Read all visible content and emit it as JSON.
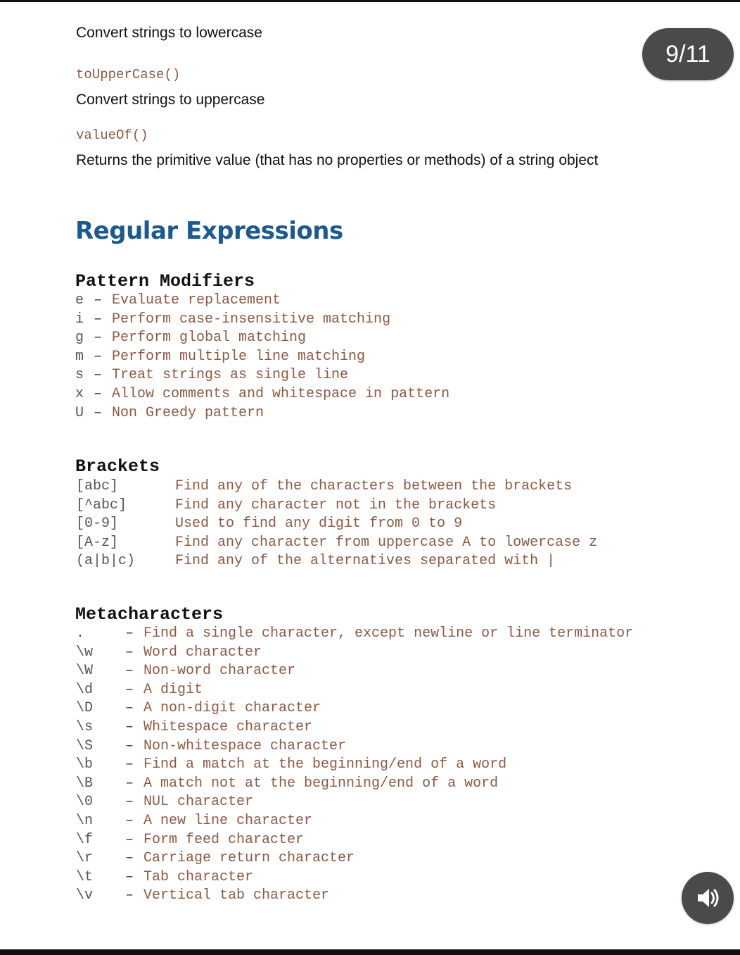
{
  "page_indicator": "9/11",
  "top_items": [
    {
      "description": "Convert strings to lowercase"
    },
    {
      "name": "toUpperCase()",
      "description": "Convert strings to uppercase"
    },
    {
      "name": "valueOf()",
      "description": "Returns the primitive value (that has no properties or methods) of a string object"
    }
  ],
  "section_title": "Regular Expressions",
  "pattern_modifiers": {
    "title": "Pattern Modifiers",
    "items": [
      {
        "key": "e",
        "dash": "–",
        "desc": "Evaluate replacement"
      },
      {
        "key": "i",
        "dash": "–",
        "desc": "Perform case-insensitive matching"
      },
      {
        "key": "g",
        "dash": "–",
        "desc": "Perform global matching"
      },
      {
        "key": "m",
        "dash": "–",
        "desc": "Perform multiple line matching"
      },
      {
        "key": "s",
        "dash": "–",
        "desc": "Treat strings as single line"
      },
      {
        "key": "x",
        "dash": "–",
        "desc": "Allow comments and whitespace in pattern"
      },
      {
        "key": "U",
        "dash": "–",
        "desc": "Non Greedy pattern"
      }
    ]
  },
  "brackets": {
    "title": "Brackets",
    "items": [
      {
        "key": "[abc]",
        "desc": "Find any of the characters between the brackets"
      },
      {
        "key": "[^abc]",
        "desc": "Find any character not in the brackets"
      },
      {
        "key": "[0-9]",
        "desc": "Used to find any digit from 0 to 9"
      },
      {
        "key": "[A-z]",
        "desc": "Find any character from uppercase A to lowercase z"
      },
      {
        "key": "(a|b|c)",
        "desc": "Find any of the alternatives separated with |"
      }
    ]
  },
  "metacharacters": {
    "title": "Metacharacters",
    "items": [
      {
        "key": ".",
        "dash": "–",
        "desc": "Find a single character, except newline or line terminator"
      },
      {
        "key": "\\w",
        "dash": "–",
        "desc": "Word character"
      },
      {
        "key": "\\W",
        "dash": "–",
        "desc": "Non-word character"
      },
      {
        "key": "\\d",
        "dash": "–",
        "desc": "A digit"
      },
      {
        "key": "\\D",
        "dash": "–",
        "desc": "A non-digit character"
      },
      {
        "key": "\\s",
        "dash": "–",
        "desc": "Whitespace character"
      },
      {
        "key": "\\S",
        "dash": "–",
        "desc": "Non-whitespace character"
      },
      {
        "key": "\\b",
        "dash": "–",
        "desc": "Find a match at the beginning/end of a word"
      },
      {
        "key": "\\B",
        "dash": "–",
        "desc": "A match not at the beginning/end of a word"
      },
      {
        "key": "\\0",
        "dash": "–",
        "desc": "NUL character"
      },
      {
        "key": "\\n",
        "dash": "–",
        "desc": "A new line character"
      },
      {
        "key": "\\f",
        "dash": "–",
        "desc": "Form feed character"
      },
      {
        "key": "\\r",
        "dash": "–",
        "desc": "Carriage return character"
      },
      {
        "key": "\\t",
        "dash": "–",
        "desc": "Tab character"
      },
      {
        "key": "\\v",
        "dash": "–",
        "desc": "Vertical tab character"
      }
    ]
  },
  "icons": {
    "sound_button": "speaker-icon"
  },
  "colors": {
    "heading": "#1d5b8c",
    "code": "#8a5a44",
    "badge": "#4a4a4a"
  }
}
